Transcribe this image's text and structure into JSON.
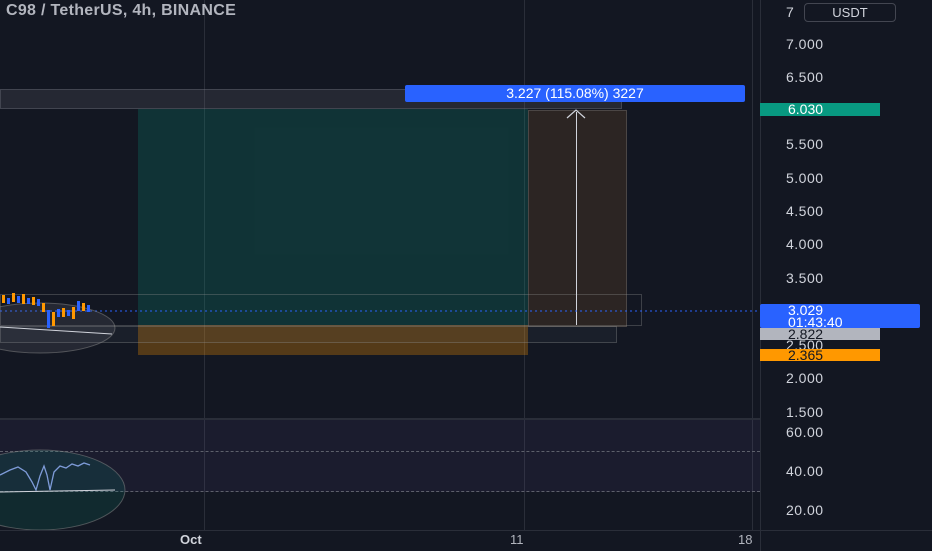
{
  "header": {
    "symbol_title": "C98 / TetherUS, 4h, BINANCE",
    "currency_button": "USDT"
  },
  "price_axis": {
    "ticks": [
      {
        "label": "7",
        "value": 7.5
      },
      {
        "label": "7.000",
        "value": 7.0
      },
      {
        "label": "6.500",
        "value": 6.5
      },
      {
        "label": "5.500",
        "value": 5.5
      },
      {
        "label": "5.000",
        "value": 5.0
      },
      {
        "label": "4.500",
        "value": 4.5
      },
      {
        "label": "4.000",
        "value": 4.0
      },
      {
        "label": "3.500",
        "value": 3.5
      },
      {
        "label": "2.500",
        "value": 2.5
      },
      {
        "label": "2.000",
        "value": 2.0
      },
      {
        "label": "1.500",
        "value": 1.5
      }
    ],
    "tags": {
      "target_price": "6.030",
      "current_price": "3.029",
      "countdown": "01:43:40",
      "gray_price": "2.822",
      "orange_price": "2.365"
    },
    "colors": {
      "target": "#089981",
      "current": "#2962ff",
      "gray": "#b2b5be",
      "orange": "#ff9800"
    }
  },
  "rsi_axis": {
    "ticks": [
      {
        "label": "60.00",
        "value": 60
      },
      {
        "label": "40.00",
        "value": 40
      },
      {
        "label": "20.00",
        "value": 20
      }
    ]
  },
  "time_axis": {
    "labels": [
      {
        "label": "Oct",
        "bold": true
      },
      {
        "label": "11",
        "bold": false
      },
      {
        "label": "18",
        "bold": false
      }
    ]
  },
  "measure": {
    "label": "3.227 (115.08%) 3227"
  }
}
